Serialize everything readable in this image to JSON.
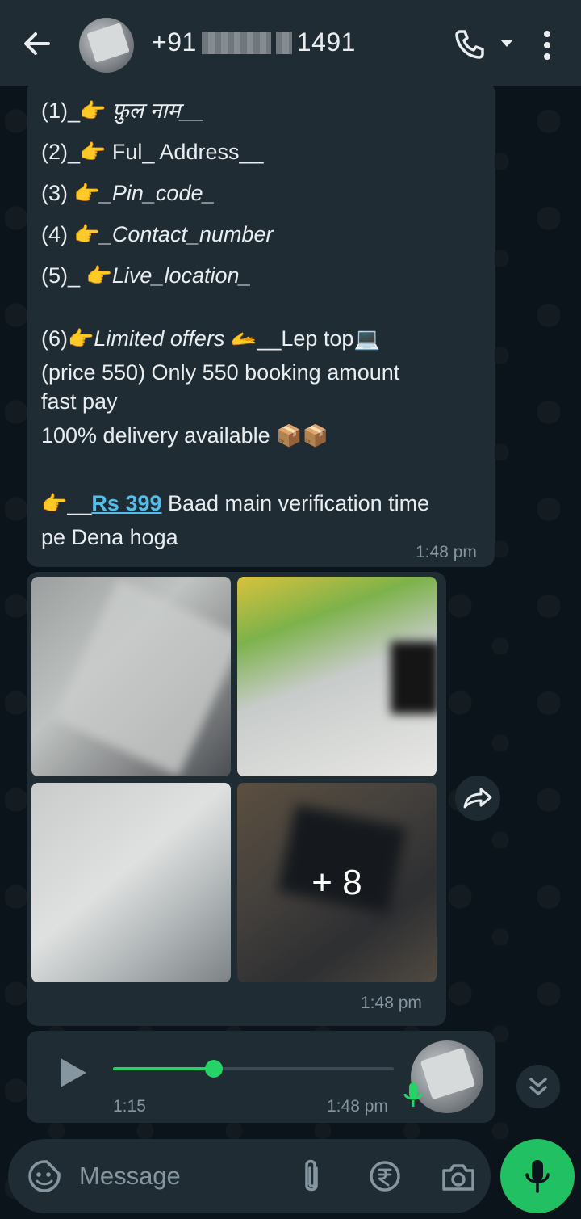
{
  "header": {
    "contact_prefix": "+91",
    "contact_suffix": "1491"
  },
  "text_message": {
    "lines": [
      {
        "num": "(1)_",
        "text": " फ़ुल  नाम__"
      },
      {
        "num": "(2)_",
        "text": " Ful_ Address__"
      },
      {
        "num": "(3) ",
        "text": "_Pin_code_"
      },
      {
        "num": "(4) ",
        "text": "_Contact_number"
      },
      {
        "num": "(5)_ ",
        "text": "Live_location_"
      }
    ],
    "offer_num": "(6)",
    "offer_italic": "Limited offers ",
    "offer_rest": "__Lep top",
    "price_line": "(price 550) Only 550 booking amount",
    "fast_pay": "fast pay",
    "delivery": "100% delivery available ",
    "pay_prefix": "__",
    "pay_link": "Rs 399",
    "pay_rest": " Baad main verification time",
    "pay_rest2": "pe Dena hoga",
    "time": "1:48 pm"
  },
  "media_message": {
    "more_count": "+ 8",
    "time": "1:48 pm"
  },
  "voice_message": {
    "duration": "1:15",
    "time": "1:48 pm",
    "progress_fraction": 0.36
  },
  "composer": {
    "placeholder": "Message"
  },
  "colors": {
    "accent": "#25d366",
    "bubble": "#1f2c34",
    "background": "#0b141a",
    "link": "#53bdeb"
  },
  "icons": [
    "back-arrow-icon",
    "phone-icon",
    "dropdown-caret-icon",
    "more-vertical-icon",
    "forward-icon",
    "play-icon",
    "mic-icon",
    "chevron-double-down-icon",
    "emoji-sticker-icon",
    "paperclip-icon",
    "rupee-icon",
    "camera-icon"
  ]
}
